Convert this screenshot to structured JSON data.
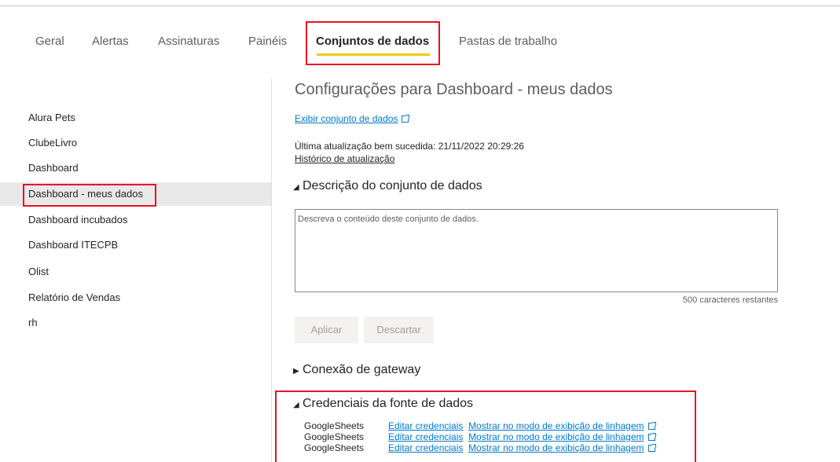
{
  "tabs": [
    {
      "label": "Geral"
    },
    {
      "label": "Alertas"
    },
    {
      "label": "Assinaturas"
    },
    {
      "label": "Painéis"
    },
    {
      "label": "Conjuntos de dados"
    },
    {
      "label": "Pastas de trabalho"
    }
  ],
  "active_tab": "Conjuntos de dados",
  "sidebar": {
    "items": [
      {
        "label": "Alura Pets"
      },
      {
        "label": "ClubeLivro"
      },
      {
        "label": "Dashboard"
      },
      {
        "label": "Dashboard - meus dados"
      },
      {
        "label": "Dashboard incubados"
      },
      {
        "label": "Dashboard ITECPB"
      },
      {
        "label": "Olist"
      },
      {
        "label": "Relatório de Vendas"
      },
      {
        "label": "rh"
      }
    ],
    "selected": "Dashboard - meus dados"
  },
  "main": {
    "title": "Configurações para Dashboard - meus dados",
    "view_dataset_link": "Exibir conjunto de dados",
    "last_refresh": "Última atualização bem sucedida: 21/11/2022 20:29:26",
    "refresh_history_link": "Histórico de atualização",
    "description_section": "Descrição do conjunto de dados",
    "description_placeholder": "Descreva o conteúdo deste conjunto de dados.",
    "description_value": "",
    "chars_remaining": "500 caracteres restantes",
    "apply_label": "Aplicar",
    "discard_label": "Descartar",
    "gateway_section": "Conexão de gateway",
    "credentials_section": "Credenciais da fonte de dados",
    "credentials": [
      {
        "source": "GoogleSheets",
        "edit": "Editar credenciais",
        "lineage": "Mostrar no modo de exibição de linhagem"
      },
      {
        "source": "GoogleSheets",
        "edit": "Editar credenciais",
        "lineage": "Mostrar no modo de exibição de linhagem"
      },
      {
        "source": "GoogleSheets",
        "edit": "Editar credenciais",
        "lineage": "Mostrar no modo de exibição de linhagem"
      }
    ]
  },
  "colors": {
    "accent_underline": "#f2c811",
    "highlight_box": "#e81123",
    "link": "#0078d4",
    "selected_bg": "#e9e9e9"
  }
}
